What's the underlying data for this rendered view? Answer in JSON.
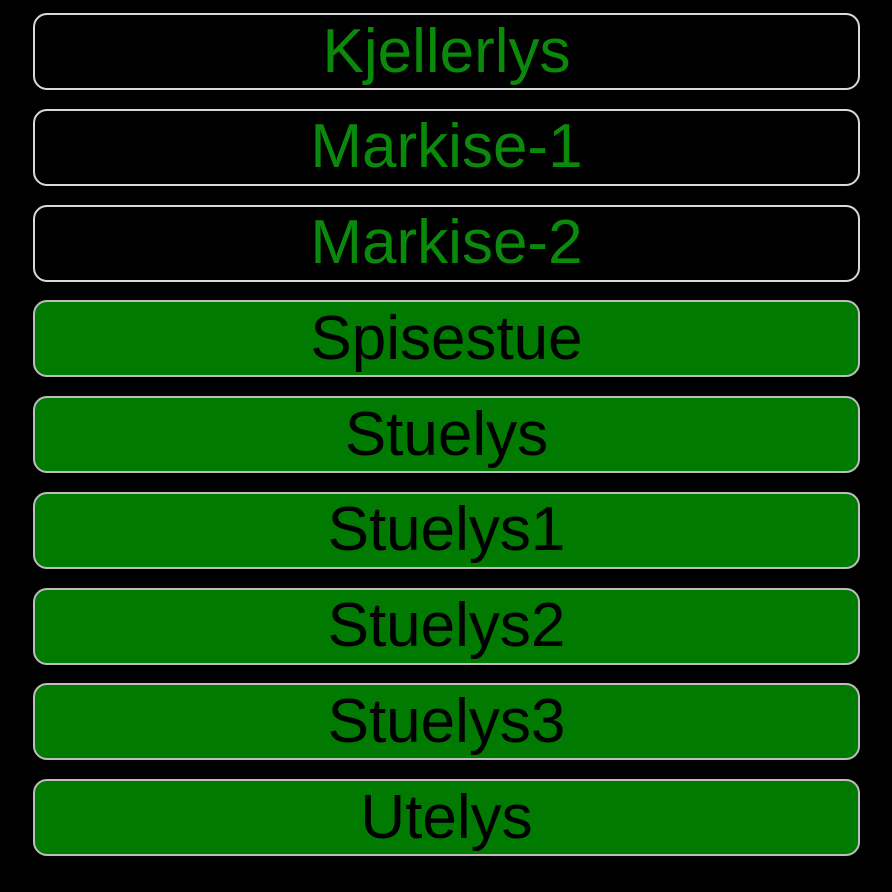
{
  "colors": {
    "background": "#000000",
    "off_text": "#0a8a0a",
    "on_fill": "#007a00",
    "on_text": "#000000",
    "border": "#c8c8c8"
  },
  "switches": [
    {
      "label": "Kjellerlys",
      "state": "off"
    },
    {
      "label": "Markise-1",
      "state": "off"
    },
    {
      "label": "Markise-2",
      "state": "off"
    },
    {
      "label": "Spisestue",
      "state": "on"
    },
    {
      "label": "Stuelys",
      "state": "on"
    },
    {
      "label": "Stuelys1",
      "state": "on"
    },
    {
      "label": "Stuelys2",
      "state": "on"
    },
    {
      "label": "Stuelys3",
      "state": "on"
    },
    {
      "label": "Utelys",
      "state": "on"
    }
  ]
}
